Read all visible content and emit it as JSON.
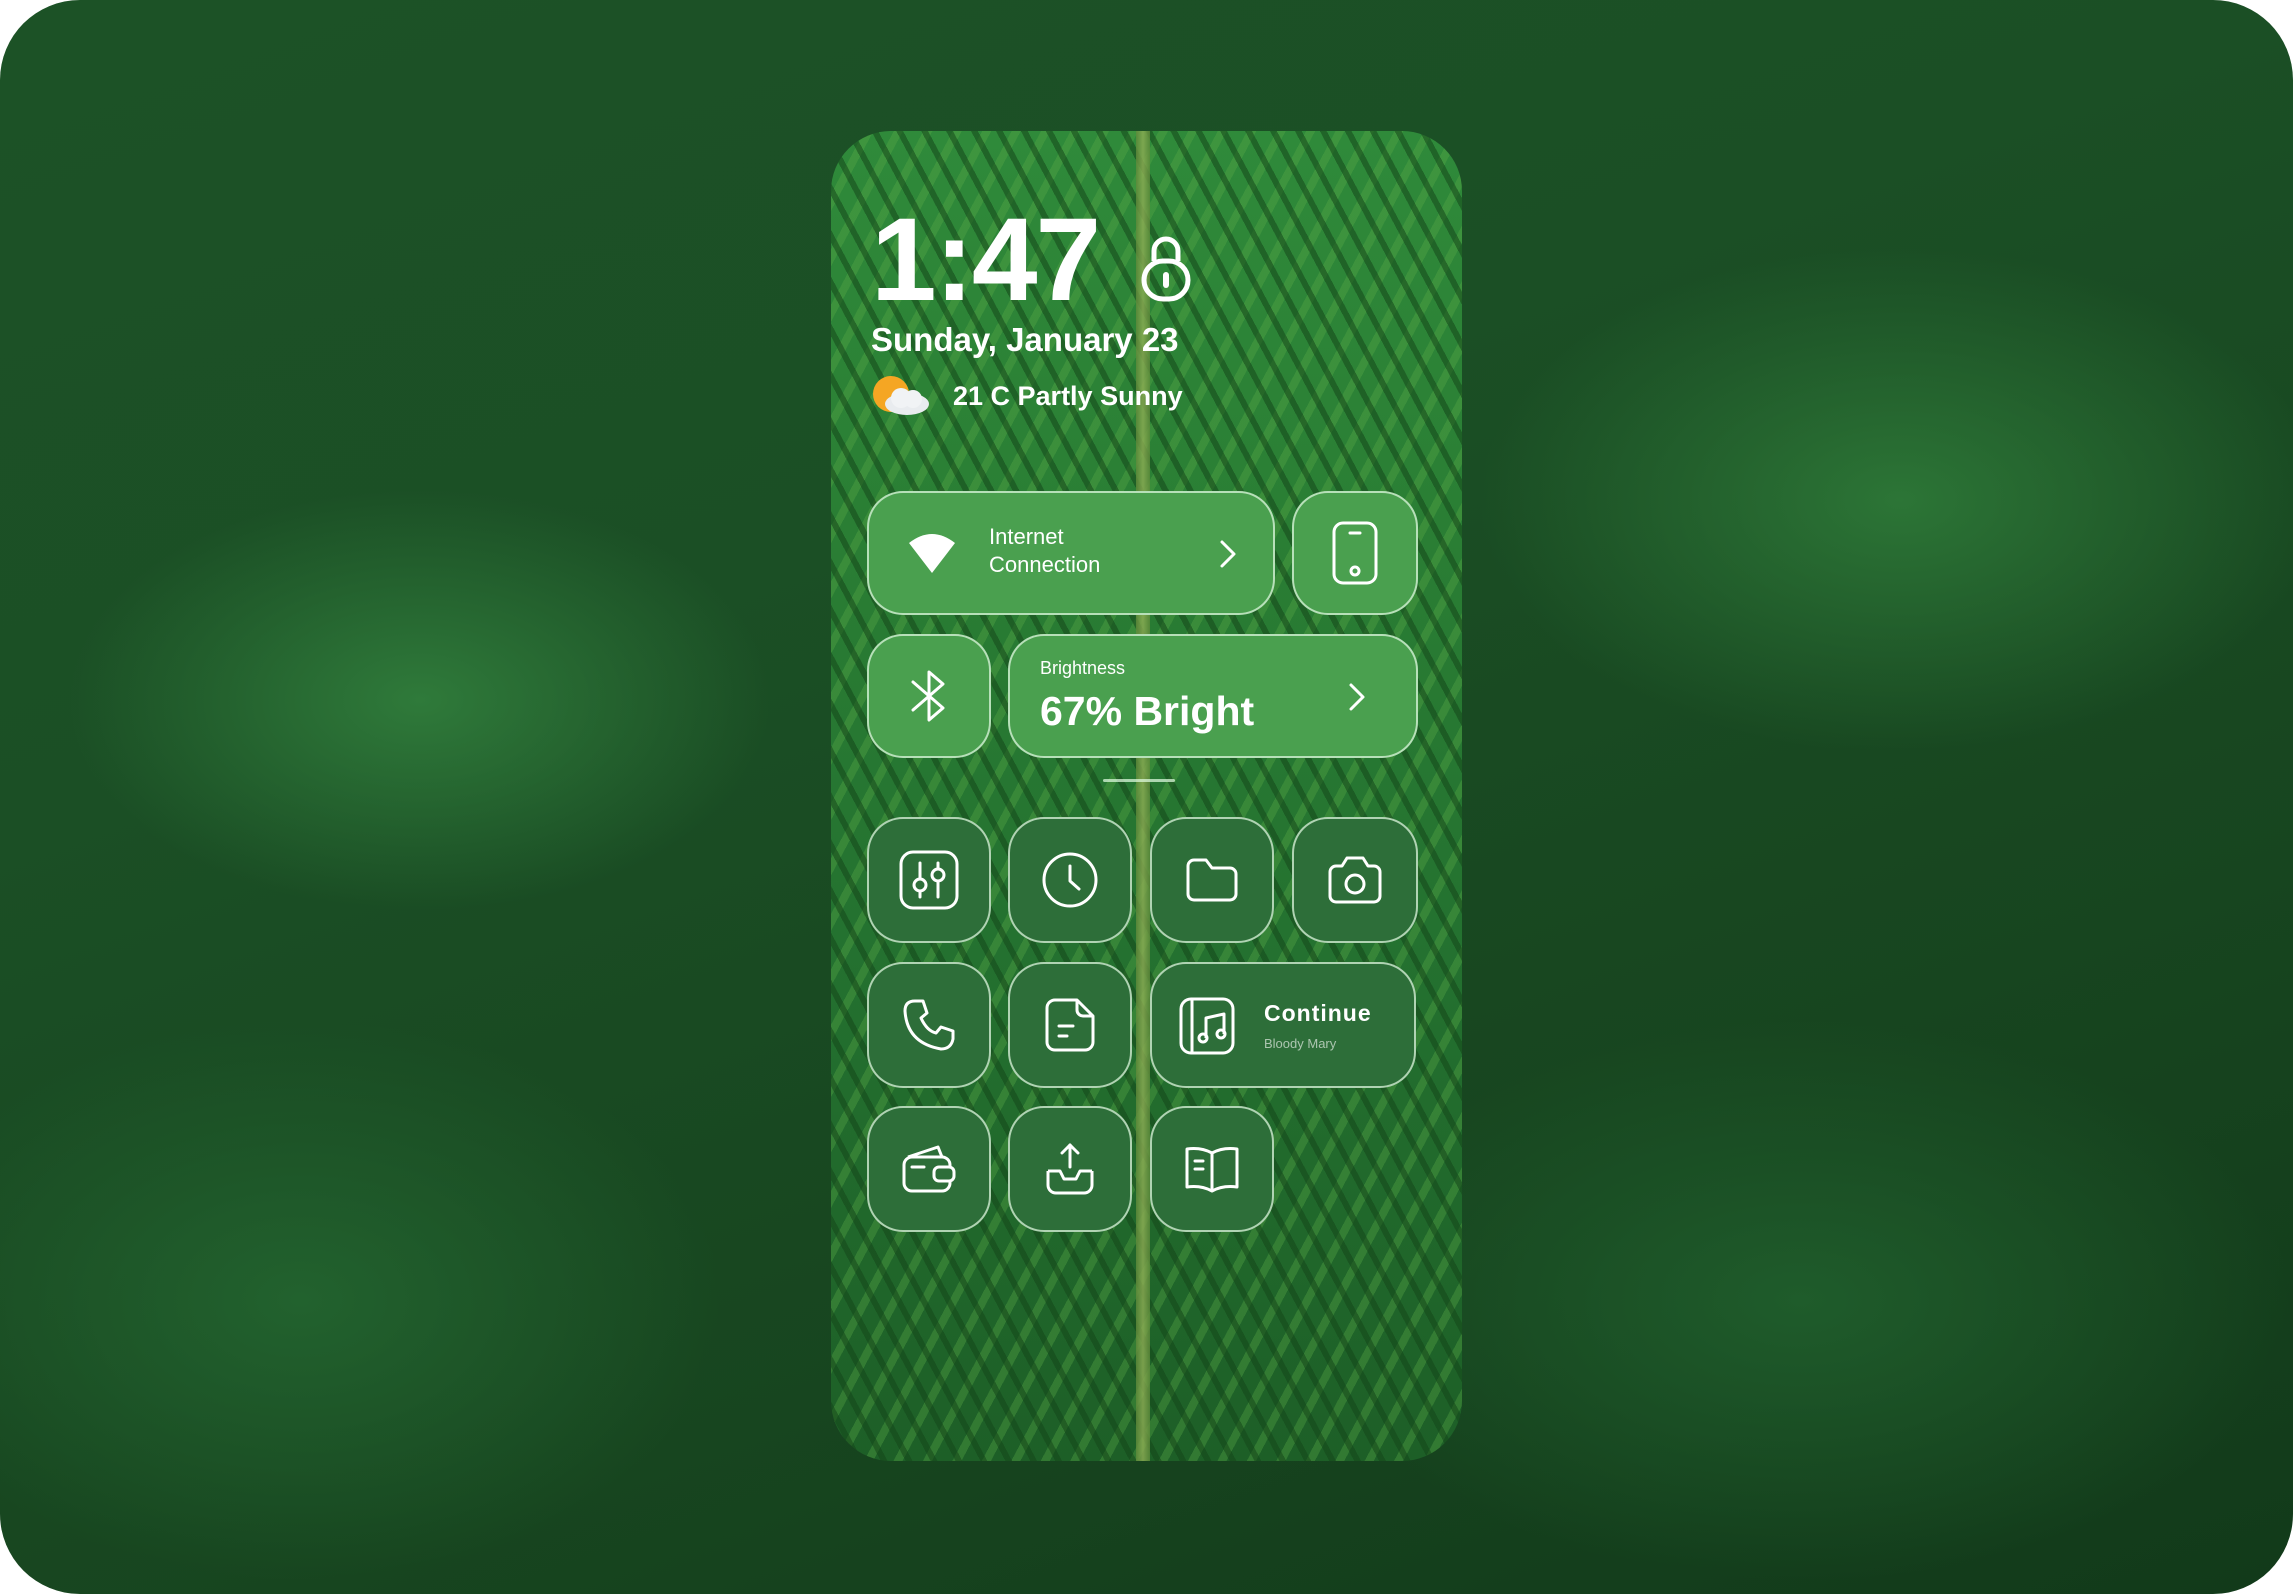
{
  "lock_screen": {
    "time": "1:47",
    "date": "Sunday, January 23",
    "weather": {
      "text": "21 C Partly Sunny",
      "icon": "partly-sunny-icon"
    }
  },
  "controls": {
    "internet": {
      "line1": "Internet",
      "line2": "Connection",
      "icon": "wifi-icon"
    },
    "device": {
      "icon": "phone-device-icon"
    },
    "bluetooth": {
      "icon": "bluetooth-icon"
    },
    "brightness": {
      "label": "Brightness",
      "value": "67% Bright",
      "level_percent": 67
    }
  },
  "apps": [
    {
      "name": "settings",
      "icon": "sliders-icon"
    },
    {
      "name": "clock",
      "icon": "clock-icon"
    },
    {
      "name": "files",
      "icon": "folder-icon"
    },
    {
      "name": "camera",
      "icon": "camera-icon"
    },
    {
      "name": "phone",
      "icon": "phone-icon"
    },
    {
      "name": "notes",
      "icon": "note-icon"
    },
    {
      "name": "wallet",
      "icon": "wallet-icon"
    },
    {
      "name": "share",
      "icon": "upload-icon"
    },
    {
      "name": "books",
      "icon": "book-icon"
    }
  ],
  "music": {
    "action": "Continue",
    "track": "Bloody Mary",
    "icon": "music-note-icon"
  },
  "colors": {
    "tile": "#4aa04f",
    "tile_dark": "#2d6e39",
    "text": "#ffffff"
  }
}
